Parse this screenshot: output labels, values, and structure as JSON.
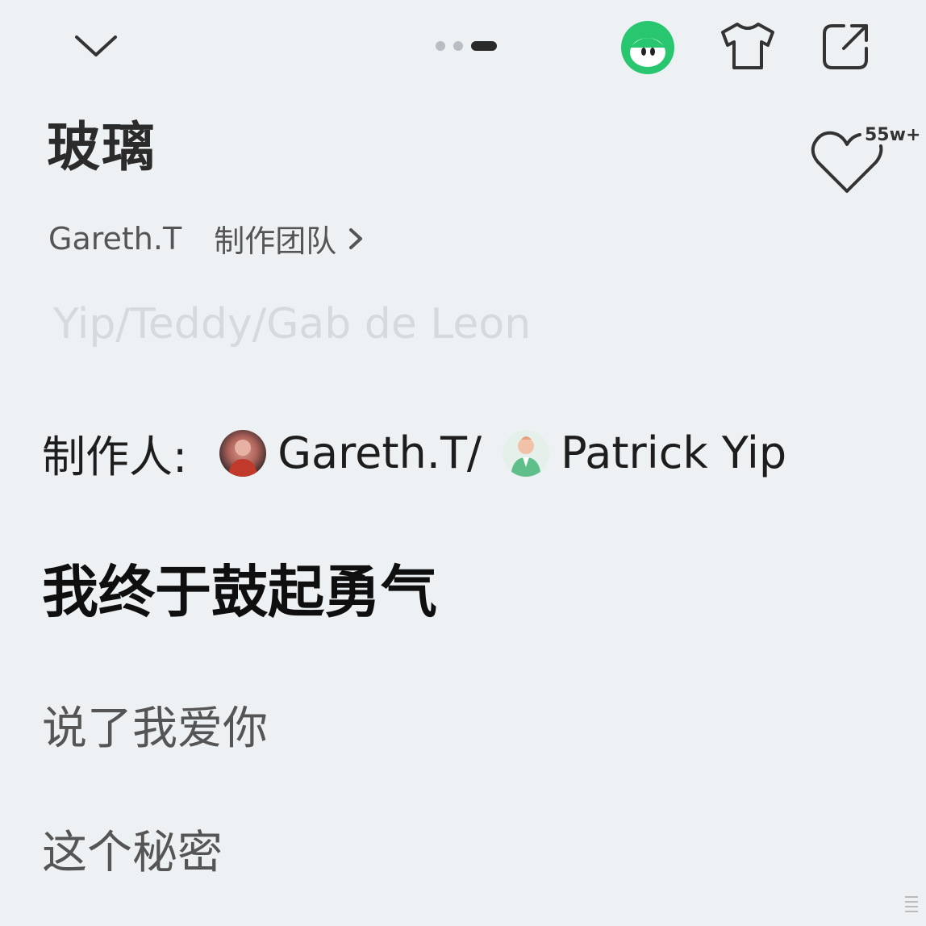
{
  "header": {
    "collapse_icon": "chevron-down-icon",
    "mascot_icon": "mascot-icon",
    "theme_icon": "shirt-icon",
    "share_icon": "share-icon",
    "pager": {
      "count": 3,
      "active": 2
    }
  },
  "song": {
    "title": "玻璃",
    "artist": "Gareth.T",
    "team_label": "制作团队",
    "credits_faded": "Yip/Teddy/Gab de Leon",
    "like_count": "55w+"
  },
  "producers": {
    "label": "制作人:",
    "names": [
      "Gareth.T/",
      "Patrick Yip"
    ]
  },
  "lyrics": {
    "active": "我终于鼓起勇气",
    "lines": [
      "说了我爱你",
      "这个秘密"
    ]
  },
  "colors": {
    "background": "#eef1f4",
    "mascot_green": "#28c76f",
    "active_text": "#0f0f0f",
    "inactive_text": "#555555"
  }
}
